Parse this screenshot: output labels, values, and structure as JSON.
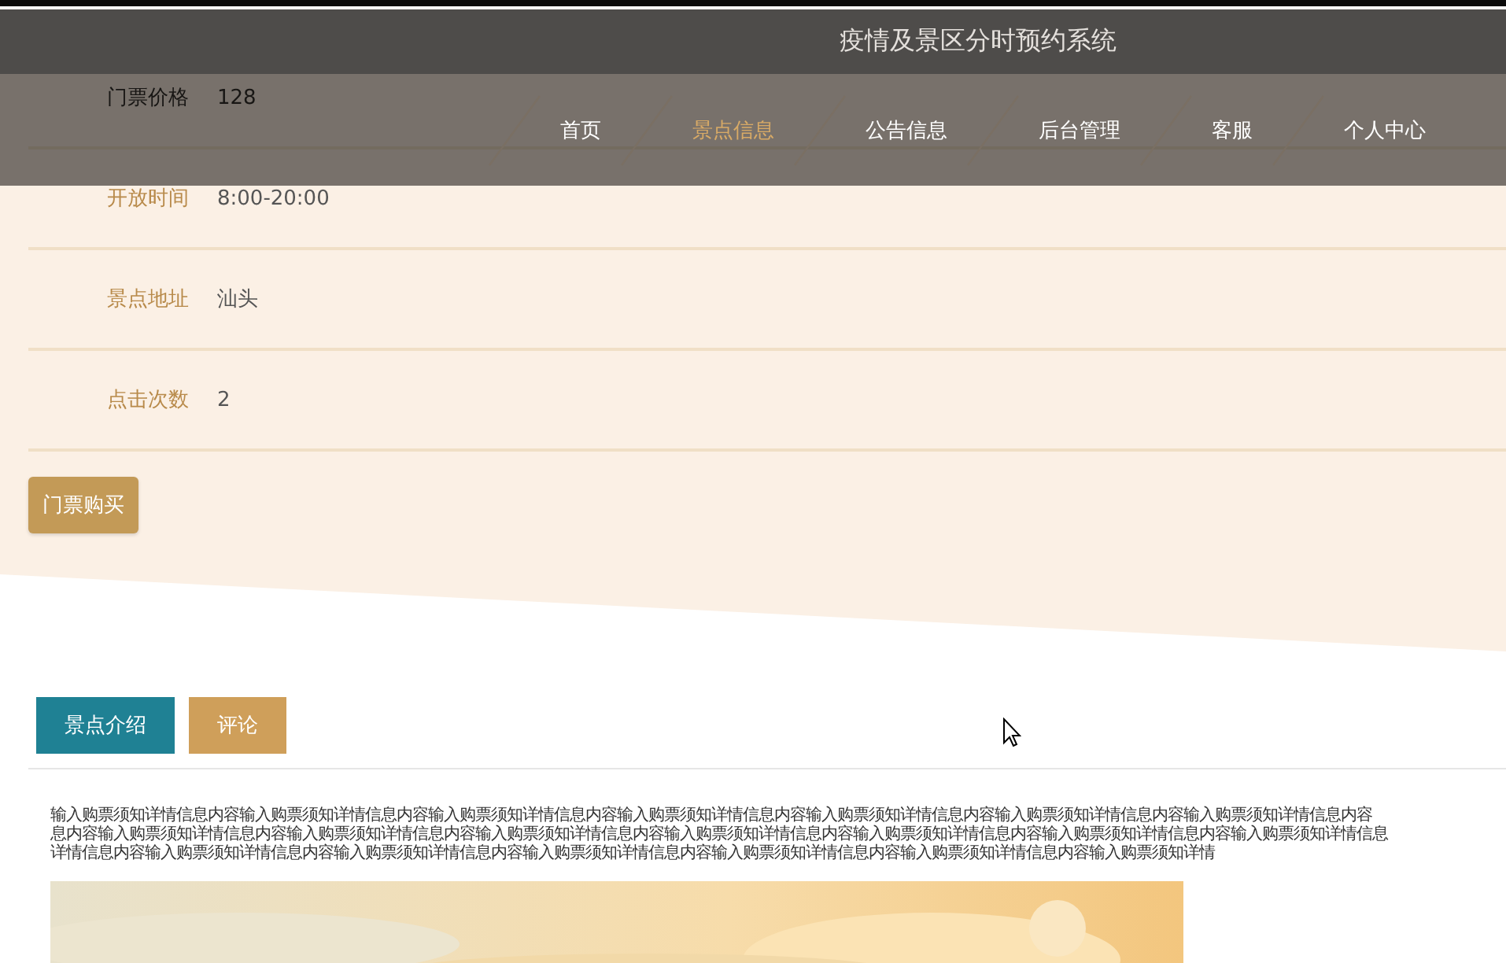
{
  "header": {
    "title": "疫情及景区分时预约系统"
  },
  "nav": [
    {
      "label": "首页",
      "selected": false
    },
    {
      "label": "景点信息",
      "selected": true
    },
    {
      "label": "公告信息",
      "selected": false
    },
    {
      "label": "后台管理",
      "selected": false
    },
    {
      "label": "客服",
      "selected": false
    },
    {
      "label": "个人中心",
      "selected": false
    }
  ],
  "details": [
    {
      "label": "门票价格",
      "value": "128"
    },
    {
      "label": "开放时间",
      "value": "8:00-20:00"
    },
    {
      "label": "景点地址",
      "value": "汕头"
    },
    {
      "label": "点击次数",
      "value": "2"
    }
  ],
  "buy_button": "门票购买",
  "tabs": [
    {
      "label": "景点介绍",
      "selected": true
    },
    {
      "label": "评论",
      "selected": false
    }
  ],
  "description": [
    "输入购票须知详情信息内容输入购票须知详情信息内容输入购票须知详情信息内容输入购票须知详情信息内容输入购票须知详情信息内容输入购票须知详情信息内容输入购票须知详情信息内容",
    "息内容输入购票须知详情信息内容输入购票须知详情信息内容输入购票须知详情信息内容输入购票须知详情信息内容输入购票须知详情信息内容输入购票须知详情信息内容输入购票须知详情信息",
    "详情信息内容输入购票须知详情信息内容输入购票须知详情信息内容输入购票须知详情信息内容输入购票须知详情信息内容输入购票须知详情信息内容输入购票须知详情"
  ],
  "image": {
    "kind": "picture"
  }
}
